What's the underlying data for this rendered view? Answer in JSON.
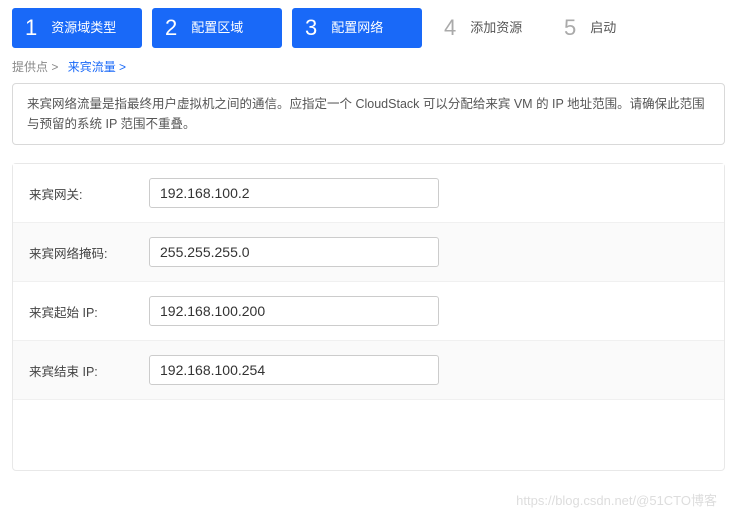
{
  "steps": [
    {
      "num": "1",
      "label": "资源域类型",
      "active": true
    },
    {
      "num": "2",
      "label": "配置区域",
      "active": true
    },
    {
      "num": "3",
      "label": "配置网络",
      "active": true
    },
    {
      "num": "4",
      "label": "添加资源",
      "active": false
    },
    {
      "num": "5",
      "label": "启动",
      "active": false
    }
  ],
  "breadcrumb": {
    "prefix": "提供点 >",
    "link": "来宾流量 >"
  },
  "description": "来宾网络流量是指最终用户虚拟机之间的通信。应指定一个 CloudStack 可以分配给来宾 VM 的 IP 地址范围。请确保此范围与预留的系统 IP 范围不重叠。",
  "fields": {
    "gateway": {
      "label": "来宾网关:",
      "value": "192.168.100.2"
    },
    "netmask": {
      "label": "来宾网络掩码:",
      "value": "255.255.255.0"
    },
    "startIp": {
      "label": "来宾起始 IP:",
      "value": "192.168.100.200"
    },
    "endIp": {
      "label": "来宾结束 IP:",
      "value": "192.168.100.254"
    }
  },
  "watermark": "https://blog.csdn.net/@51CTO博客"
}
